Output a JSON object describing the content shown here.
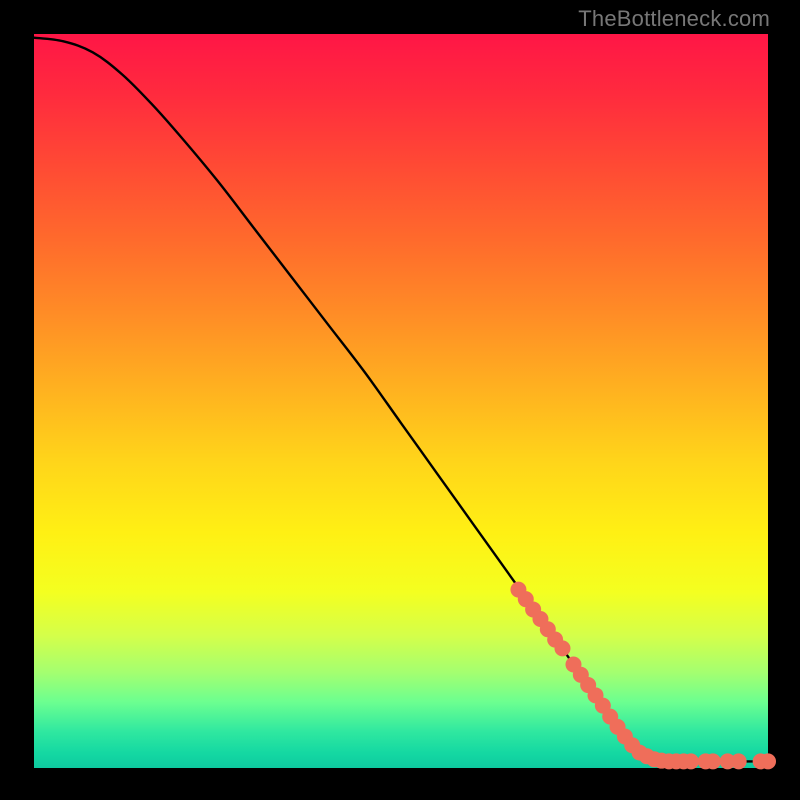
{
  "watermark": "TheBottleneck.com",
  "chart_data": {
    "type": "line",
    "title": "",
    "xlabel": "",
    "ylabel": "",
    "xlim": [
      0,
      100
    ],
    "ylim": [
      0,
      100
    ],
    "grid": false,
    "curve": [
      {
        "x": 0,
        "y": 99.5
      },
      {
        "x": 4,
        "y": 99.0
      },
      {
        "x": 8,
        "y": 97.5
      },
      {
        "x": 12,
        "y": 94.5
      },
      {
        "x": 16,
        "y": 90.5
      },
      {
        "x": 20,
        "y": 86.0
      },
      {
        "x": 25,
        "y": 80.0
      },
      {
        "x": 30,
        "y": 73.5
      },
      {
        "x": 35,
        "y": 67.0
      },
      {
        "x": 40,
        "y": 60.5
      },
      {
        "x": 45,
        "y": 54.0
      },
      {
        "x": 50,
        "y": 47.0
      },
      {
        "x": 55,
        "y": 40.0
      },
      {
        "x": 60,
        "y": 33.0
      },
      {
        "x": 65,
        "y": 26.0
      },
      {
        "x": 70,
        "y": 19.0
      },
      {
        "x": 75,
        "y": 12.0
      },
      {
        "x": 79,
        "y": 6.0
      },
      {
        "x": 82,
        "y": 2.5
      },
      {
        "x": 84,
        "y": 1.2
      },
      {
        "x": 87,
        "y": 0.9
      },
      {
        "x": 90,
        "y": 0.9
      },
      {
        "x": 95,
        "y": 0.9
      },
      {
        "x": 100,
        "y": 0.9
      }
    ],
    "series": [
      {
        "name": "highlight-points",
        "color": "#ef6e5a",
        "r": 8,
        "points": [
          {
            "x": 66,
            "y": 24.3
          },
          {
            "x": 67,
            "y": 23.0
          },
          {
            "x": 68,
            "y": 21.6
          },
          {
            "x": 69,
            "y": 20.3
          },
          {
            "x": 70,
            "y": 18.9
          },
          {
            "x": 71,
            "y": 17.5
          },
          {
            "x": 72,
            "y": 16.3
          },
          {
            "x": 73.5,
            "y": 14.1
          },
          {
            "x": 74.5,
            "y": 12.7
          },
          {
            "x": 75.5,
            "y": 11.3
          },
          {
            "x": 76.5,
            "y": 9.9
          },
          {
            "x": 77.5,
            "y": 8.5
          },
          {
            "x": 78.5,
            "y": 7.0
          },
          {
            "x": 79.5,
            "y": 5.6
          },
          {
            "x": 80.5,
            "y": 4.3
          },
          {
            "x": 81.5,
            "y": 3.1
          },
          {
            "x": 82.5,
            "y": 2.1
          },
          {
            "x": 83.5,
            "y": 1.6
          },
          {
            "x": 84.5,
            "y": 1.2
          },
          {
            "x": 85.5,
            "y": 1.0
          },
          {
            "x": 86.5,
            "y": 0.9
          },
          {
            "x": 87.5,
            "y": 0.9
          },
          {
            "x": 88.5,
            "y": 0.9
          },
          {
            "x": 89.5,
            "y": 0.9
          },
          {
            "x": 91.5,
            "y": 0.9
          },
          {
            "x": 92.5,
            "y": 0.9
          },
          {
            "x": 94.5,
            "y": 0.9
          },
          {
            "x": 96.0,
            "y": 0.9
          },
          {
            "x": 99.0,
            "y": 0.9
          },
          {
            "x": 100.0,
            "y": 0.9
          }
        ]
      }
    ]
  }
}
